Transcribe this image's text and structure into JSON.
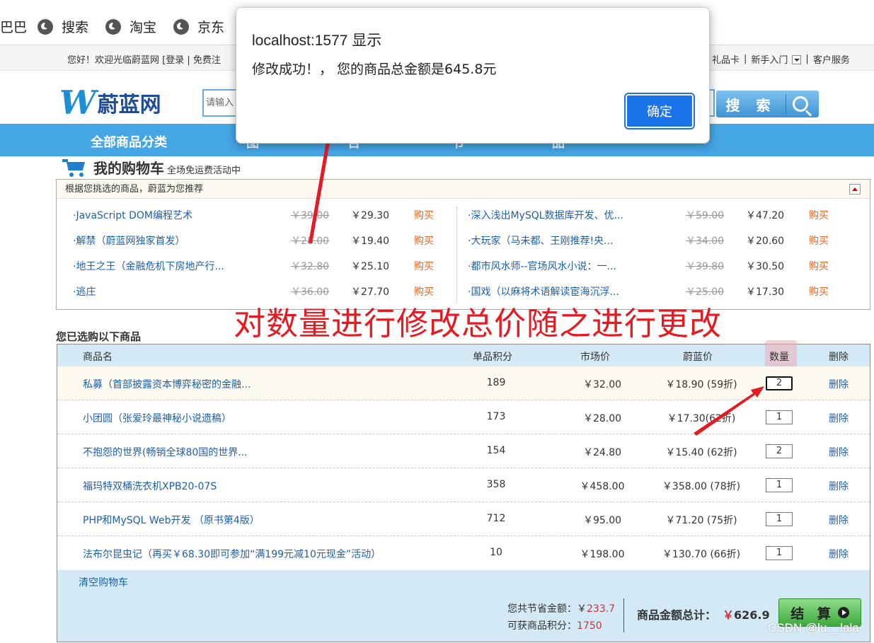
{
  "bookmarks": [
    {
      "label": "巴巴",
      "icon": "none"
    },
    {
      "label": "搜索",
      "icon": "globe-icon"
    },
    {
      "label": "淘宝",
      "icon": "globe-icon"
    },
    {
      "label": "京东",
      "icon": "globe-icon"
    }
  ],
  "topbar": {
    "welcome": "您好！欢迎光临蔚蓝网 [登录 | 免费注",
    "links": [
      "礼品卡",
      "|",
      "新手入门",
      "|",
      "客户服务"
    ]
  },
  "logo": {
    "mark": "W",
    "name": "蔚蓝网"
  },
  "search": {
    "placeholder": "请输入",
    "button": "搜 索"
  },
  "nav": {
    "category": "全部商品分类",
    "items": [
      "图",
      "音",
      "百",
      "书",
      "品"
    ]
  },
  "cart_header": {
    "title": "我的购物车",
    "subtitle": "全场免运费活动中"
  },
  "recommend": {
    "header": "根据您挑选的商品，蔚蓝为您推荐",
    "items": [
      {
        "name": "·JavaScript DOM编程艺术",
        "old_price": "￥39.00",
        "price": "￥29.30",
        "buy": "购买"
      },
      {
        "name": "·深入浅出MySQL数据库开发、优...",
        "old_price": "￥59.00",
        "price": "￥47.20",
        "buy": "购买"
      },
      {
        "name": "·解禁（蔚蓝网独家首发）",
        "old_price": "￥28.00",
        "price": "￥19.40",
        "buy": "购买"
      },
      {
        "name": "·大玩家（马未都、王刚推荐!央...",
        "old_price": "￥34.00",
        "price": "￥20.60",
        "buy": "购买"
      },
      {
        "name": "·地王之王（金融危机下房地产行...",
        "old_price": "￥32.80",
        "price": "￥25.10",
        "buy": "购买"
      },
      {
        "name": "·都市风水师--官场风水小说：一...",
        "old_price": "￥39.80",
        "price": "￥30.50",
        "buy": "购买"
      },
      {
        "name": "·逃庄",
        "old_price": "￥36.00",
        "price": "￥27.70",
        "buy": "购买"
      },
      {
        "name": "·国戏（以麻将术语解读宦海沉浮...",
        "old_price": "￥25.00",
        "price": "￥17.30",
        "buy": "购买"
      }
    ]
  },
  "annotation": "对数量进行修改总价随之进行更改",
  "cart": {
    "section_title": "您已选购以下商品",
    "headers": {
      "name": "商品名",
      "points": "单品积分",
      "market": "市场价",
      "weilan": "蔚蓝价",
      "qty": "数量",
      "delete": "删除"
    },
    "rows": [
      {
        "name": "私募（首部披露资本博弈秘密的金融...",
        "points": "189",
        "market": "￥32.00",
        "weilan": "￥18.90 (59折)",
        "qty": "2",
        "delete": "删除"
      },
      {
        "name": "小团圆（张爱玲最神秘小说遗稿）",
        "points": "173",
        "market": "￥28.00",
        "weilan": "￥17.30(62折)",
        "qty": "1",
        "delete": "删除"
      },
      {
        "name": "不抱怨的世界(畅销全球80国的世界...",
        "points": "154",
        "market": "￥24.80",
        "weilan": "￥15.40 (62折)",
        "qty": "2",
        "delete": "删除"
      },
      {
        "name": "福玛特双桶洗衣机XPB20-07S",
        "points": "358",
        "market": "￥458.00",
        "weilan": "￥358.00 (78折)",
        "qty": "1",
        "delete": "删除"
      },
      {
        "name": "PHP和MySQL Web开发 （原书第4版）",
        "points": "712",
        "market": "￥95.00",
        "weilan": "￥71.20 (75折)",
        "qty": "1",
        "delete": "删除"
      },
      {
        "name": "法布尔昆虫记（再买￥68.30即可参加“满199元减10元现金”活动）",
        "points": "10",
        "market": "￥198.00",
        "weilan": "￥130.70 (66折)",
        "qty": "1",
        "delete": "删除"
      }
    ],
    "clear": "清空购物车",
    "savings_label": "您共节省金额：￥",
    "savings_value": "233.7",
    "points_label": "可获商品积分：",
    "points_value": "1750",
    "total_label": "商品金额总计：",
    "total_currency": "￥",
    "total_value": "626.9",
    "checkout": "结 算"
  },
  "dialog": {
    "title": "localhost:1577 显示",
    "message": "修改成功！，  您的商品总金额是645.8元",
    "ok": "确定"
  },
  "watermark": "CSDN @lu__lala"
}
